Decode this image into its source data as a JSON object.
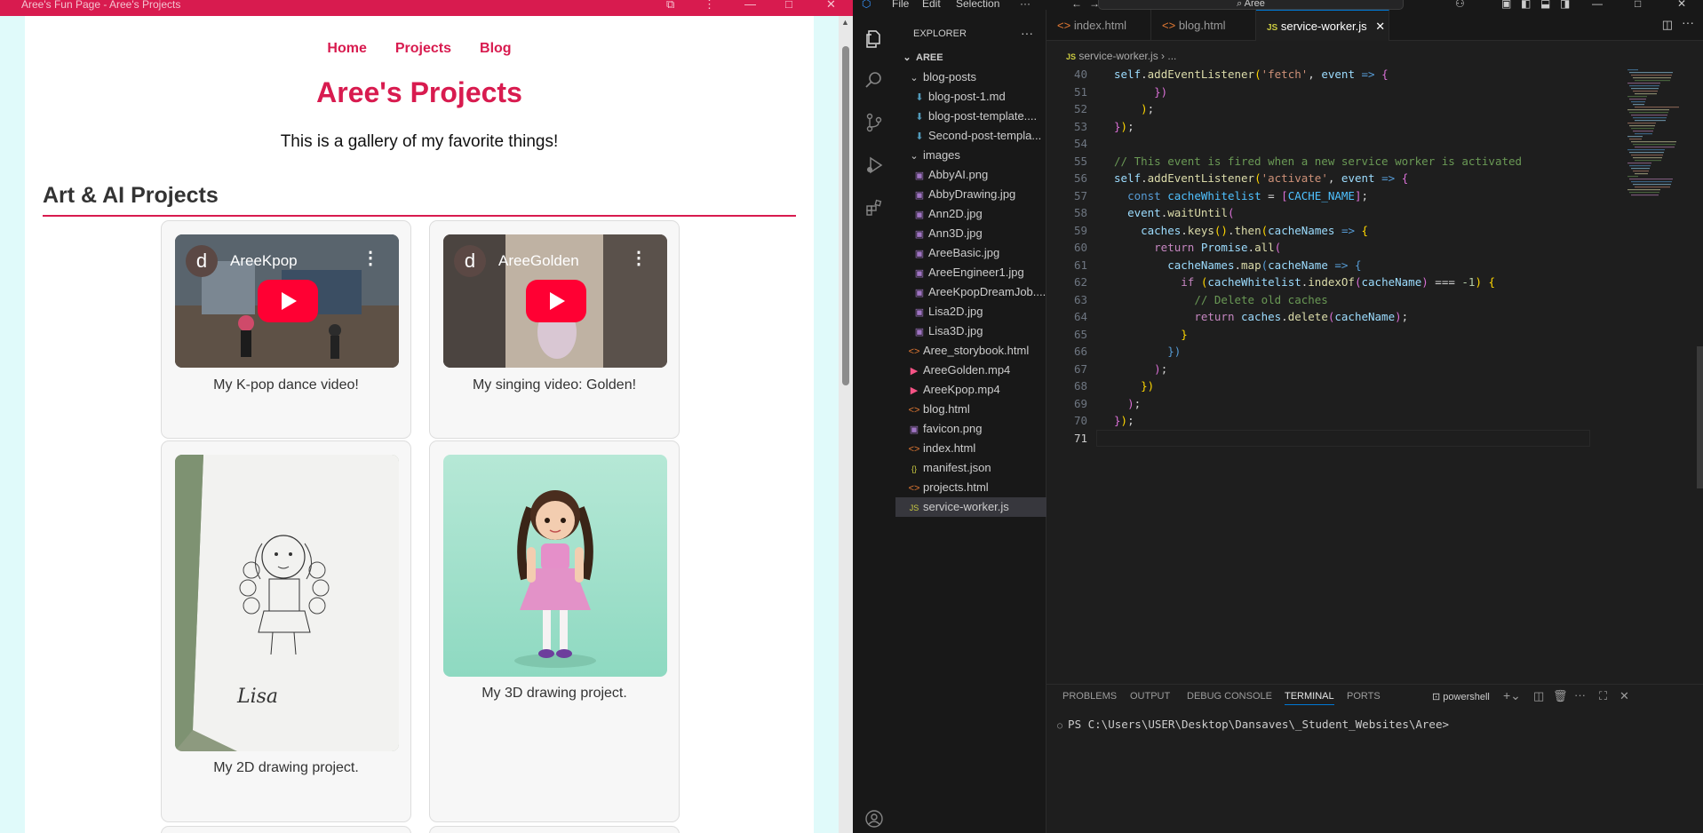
{
  "browser": {
    "window_title": "Aree's Fun Page - Aree's Projects",
    "nav": [
      "Home",
      "Projects",
      "Blog"
    ],
    "page_title": "Aree's Projects",
    "subtitle": "This is a gallery of my favorite things!",
    "section_title": "Art & AI Projects",
    "cards": [
      {
        "channel_initial": "d",
        "video_title": "AreeKpop",
        "caption": "My K-pop dance video!"
      },
      {
        "channel_initial": "d",
        "video_title": "AreeGolden",
        "caption": "My singing video: Golden!"
      },
      {
        "handwriting": "Lisa",
        "caption": "My 2D drawing project."
      },
      {
        "caption": "My 3D drawing project."
      }
    ]
  },
  "vscode": {
    "menu": [
      "File",
      "Edit",
      "Selection",
      "···"
    ],
    "search": "Aree",
    "explorer": {
      "header": "EXPLORER",
      "root": "AREE",
      "items": [
        {
          "name": "blog-posts",
          "type": "folder",
          "depth": 1
        },
        {
          "name": "blog-post-1.md",
          "type": "md",
          "depth": 2
        },
        {
          "name": "blog-post-template....",
          "type": "md",
          "depth": 2
        },
        {
          "name": "Second-post-templa...",
          "type": "md",
          "depth": 2
        },
        {
          "name": "images",
          "type": "folder",
          "depth": 1
        },
        {
          "name": "AbbyAI.png",
          "type": "img",
          "depth": 2
        },
        {
          "name": "AbbyDrawing.jpg",
          "type": "img",
          "depth": 2
        },
        {
          "name": "Ann2D.jpg",
          "type": "img",
          "depth": 2
        },
        {
          "name": "Ann3D.jpg",
          "type": "img",
          "depth": 2
        },
        {
          "name": "AreeBasic.jpg",
          "type": "img",
          "depth": 2
        },
        {
          "name": "AreeEngineer1.jpg",
          "type": "img",
          "depth": 2
        },
        {
          "name": "AreeKpopDreamJob....",
          "type": "img",
          "depth": 2
        },
        {
          "name": "Lisa2D.jpg",
          "type": "img",
          "depth": 2
        },
        {
          "name": "Lisa3D.jpg",
          "type": "img",
          "depth": 2
        },
        {
          "name": "Aree_storybook.html",
          "type": "html",
          "depth": 1
        },
        {
          "name": "AreeGolden.mp4",
          "type": "mp4",
          "depth": 1
        },
        {
          "name": "AreeKpop.mp4",
          "type": "mp4",
          "depth": 1
        },
        {
          "name": "blog.html",
          "type": "html",
          "depth": 1
        },
        {
          "name": "favicon.png",
          "type": "img",
          "depth": 1
        },
        {
          "name": "index.html",
          "type": "html",
          "depth": 1
        },
        {
          "name": "manifest.json",
          "type": "json",
          "depth": 1
        },
        {
          "name": "projects.html",
          "type": "html",
          "depth": 1
        },
        {
          "name": "service-worker.js",
          "type": "js",
          "depth": 1,
          "selected": true
        }
      ]
    },
    "tabs": [
      {
        "label": "index.html",
        "icon": "<>"
      },
      {
        "label": "blog.html",
        "icon": "<>"
      },
      {
        "label": "service-worker.js",
        "icon": "JS",
        "active": true
      }
    ],
    "breadcrumb": [
      "service-worker.js",
      "..."
    ],
    "code_lines": [
      {
        "n": "40",
        "tokens": [
          [
            "v",
            "self"
          ],
          [
            "d",
            "."
          ],
          [
            "f",
            "addEventListener"
          ],
          [
            "y",
            "("
          ],
          [
            "s",
            "'fetch'"
          ],
          [
            "d",
            ", "
          ],
          [
            "v",
            "event"
          ],
          [
            "d",
            " "
          ],
          [
            "k",
            "=>"
          ],
          [
            "d",
            " "
          ],
          [
            "p",
            "{"
          ]
        ]
      },
      {
        "n": "51",
        "tokens": [
          [
            "d",
            "      "
          ],
          [
            "p",
            "})"
          ]
        ]
      },
      {
        "n": "52",
        "tokens": [
          [
            "d",
            "    "
          ],
          [
            "y",
            ")"
          ],
          [
            "d",
            ";"
          ]
        ]
      },
      {
        "n": "53",
        "tokens": [
          [
            "p",
            "}"
          ],
          [
            "y",
            ")"
          ],
          [
            "d",
            ";"
          ]
        ]
      },
      {
        "n": "54",
        "tokens": []
      },
      {
        "n": "55",
        "tokens": [
          [
            "c",
            "// This event is fired when a new service worker is activated"
          ]
        ]
      },
      {
        "n": "56",
        "tokens": [
          [
            "v",
            "self"
          ],
          [
            "d",
            "."
          ],
          [
            "f",
            "addEventListener"
          ],
          [
            "y",
            "("
          ],
          [
            "s",
            "'activate'"
          ],
          [
            "d",
            ", "
          ],
          [
            "v",
            "event"
          ],
          [
            "d",
            " "
          ],
          [
            "k",
            "=>"
          ],
          [
            "d",
            " "
          ],
          [
            "p",
            "{"
          ]
        ]
      },
      {
        "n": "57",
        "tokens": [
          [
            "d",
            "  "
          ],
          [
            "k",
            "const"
          ],
          [
            "d",
            " "
          ],
          [
            "cst",
            "cacheWhitelist"
          ],
          [
            "d",
            " = "
          ],
          [
            "p",
            "["
          ],
          [
            "cst",
            "CACHE_NAME"
          ],
          [
            "p",
            "]"
          ],
          [
            "d",
            ";"
          ]
        ]
      },
      {
        "n": "58",
        "tokens": [
          [
            "d",
            "  "
          ],
          [
            "v",
            "event"
          ],
          [
            "d",
            "."
          ],
          [
            "f",
            "waitUntil"
          ],
          [
            "p",
            "("
          ]
        ]
      },
      {
        "n": "59",
        "tokens": [
          [
            "d",
            "    "
          ],
          [
            "v",
            "caches"
          ],
          [
            "d",
            "."
          ],
          [
            "f",
            "keys"
          ],
          [
            "y",
            "()"
          ],
          [
            "d",
            "."
          ],
          [
            "f",
            "then"
          ],
          [
            "y",
            "("
          ],
          [
            "v",
            "cacheNames"
          ],
          [
            "d",
            " "
          ],
          [
            "k",
            "=>"
          ],
          [
            "d",
            " "
          ],
          [
            "y",
            "{"
          ]
        ]
      },
      {
        "n": "60",
        "tokens": [
          [
            "d",
            "      "
          ],
          [
            "kw",
            "return"
          ],
          [
            "d",
            " "
          ],
          [
            "v",
            "Promise"
          ],
          [
            "d",
            "."
          ],
          [
            "f",
            "all"
          ],
          [
            "p",
            "("
          ]
        ]
      },
      {
        "n": "61",
        "tokens": [
          [
            "d",
            "        "
          ],
          [
            "v",
            "cacheNames"
          ],
          [
            "d",
            "."
          ],
          [
            "f",
            "map"
          ],
          [
            "k",
            "("
          ],
          [
            "v",
            "cacheName"
          ],
          [
            "d",
            " "
          ],
          [
            "k",
            "=>"
          ],
          [
            "d",
            " "
          ],
          [
            "k",
            "{"
          ]
        ]
      },
      {
        "n": "62",
        "tokens": [
          [
            "d",
            "          "
          ],
          [
            "kw",
            "if"
          ],
          [
            "d",
            " "
          ],
          [
            "y",
            "("
          ],
          [
            "v",
            "cacheWhitelist"
          ],
          [
            "d",
            "."
          ],
          [
            "f",
            "indexOf"
          ],
          [
            "p",
            "("
          ],
          [
            "v",
            "cacheName"
          ],
          [
            "p",
            ")"
          ],
          [
            "d",
            " === "
          ],
          [
            "n",
            "-1"
          ],
          [
            "y",
            ")"
          ],
          [
            "d",
            " "
          ],
          [
            "y",
            "{"
          ]
        ]
      },
      {
        "n": "63",
        "tokens": [
          [
            "d",
            "            "
          ],
          [
            "c",
            "// Delete old caches"
          ]
        ]
      },
      {
        "n": "64",
        "tokens": [
          [
            "d",
            "            "
          ],
          [
            "kw",
            "return"
          ],
          [
            "d",
            " "
          ],
          [
            "v",
            "caches"
          ],
          [
            "d",
            "."
          ],
          [
            "f",
            "delete"
          ],
          [
            "p",
            "("
          ],
          [
            "v",
            "cacheName"
          ],
          [
            "p",
            ")"
          ],
          [
            "d",
            ";"
          ]
        ]
      },
      {
        "n": "65",
        "tokens": [
          [
            "d",
            "          "
          ],
          [
            "y",
            "}"
          ]
        ]
      },
      {
        "n": "66",
        "tokens": [
          [
            "d",
            "        "
          ],
          [
            "k",
            "})"
          ]
        ]
      },
      {
        "n": "67",
        "tokens": [
          [
            "d",
            "      "
          ],
          [
            "p",
            ")"
          ],
          [
            "d",
            ";"
          ]
        ]
      },
      {
        "n": "68",
        "tokens": [
          [
            "d",
            "    "
          ],
          [
            "y",
            "})"
          ]
        ]
      },
      {
        "n": "69",
        "tokens": [
          [
            "d",
            "  "
          ],
          [
            "p",
            ")"
          ],
          [
            "d",
            ";"
          ]
        ]
      },
      {
        "n": "70",
        "tokens": [
          [
            "p",
            "}"
          ],
          [
            "y",
            ")"
          ],
          [
            "d",
            ";"
          ]
        ]
      },
      {
        "n": "71",
        "tokens": []
      }
    ],
    "panel_tabs": [
      "PROBLEMS",
      "OUTPUT",
      "DEBUG CONSOLE",
      "TERMINAL",
      "PORTS"
    ],
    "active_panel": "TERMINAL",
    "terminal_shell": "powershell",
    "terminal_prompt": "PS C:\\Users\\USER\\Desktop\\Dansaves\\_Student_Websites\\Aree>"
  }
}
